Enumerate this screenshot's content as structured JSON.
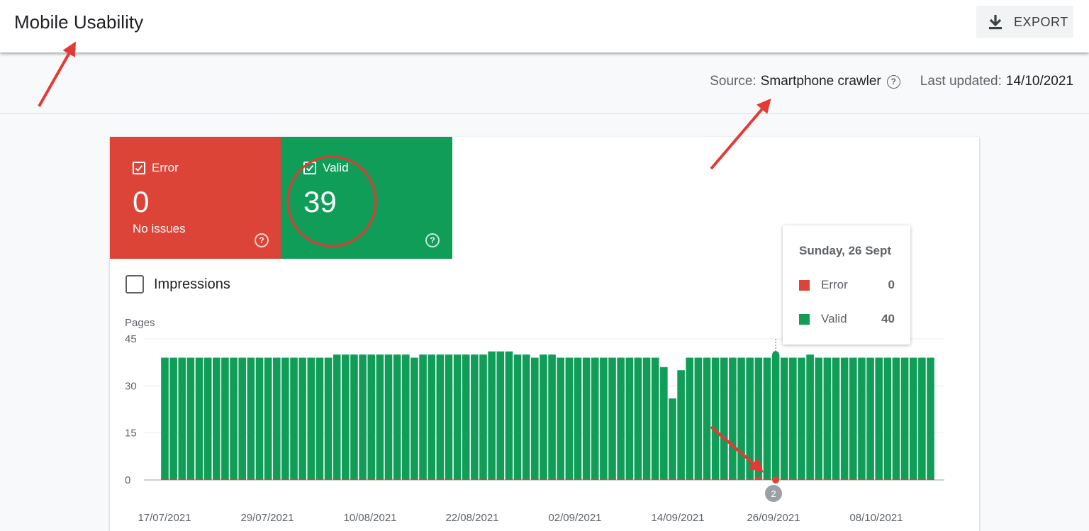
{
  "header": {
    "title": "Mobile Usability",
    "export_label": "EXPORT"
  },
  "info": {
    "source_label": "Source:",
    "source_value": "Smartphone crawler",
    "updated_label": "Last updated:",
    "updated_value": "14/10/2021"
  },
  "tiles": {
    "error": {
      "label": "Error",
      "count": "0",
      "sub": "No issues",
      "color": "#db4437"
    },
    "valid": {
      "label": "Valid",
      "count": "39",
      "color": "#0f9d58"
    }
  },
  "impressions_label": "Impressions",
  "tooltip": {
    "title": "Sunday, 26 Sept",
    "rows": [
      {
        "name": "Error",
        "value": "0",
        "color": "#db4437"
      },
      {
        "name": "Valid",
        "value": "40",
        "color": "#0f9d58"
      }
    ]
  },
  "annotation_marker": "2",
  "chart_data": {
    "type": "bar",
    "ylabel": "Pages",
    "ylim": [
      0,
      45
    ],
    "yticks": [
      0,
      15,
      30,
      45
    ],
    "grid": true,
    "xtick_labels": [
      "17/07/2021",
      "29/07/2021",
      "10/08/2021",
      "22/08/2021",
      "02/09/2021",
      "14/09/2021",
      "26/09/2021",
      "08/10/2021"
    ],
    "x": [
      "17/07/2021",
      "18/07/2021",
      "19/07/2021",
      "20/07/2021",
      "21/07/2021",
      "22/07/2021",
      "23/07/2021",
      "24/07/2021",
      "25/07/2021",
      "26/07/2021",
      "27/07/2021",
      "28/07/2021",
      "29/07/2021",
      "30/07/2021",
      "31/07/2021",
      "01/08/2021",
      "02/08/2021",
      "03/08/2021",
      "04/08/2021",
      "05/08/2021",
      "06/08/2021",
      "07/08/2021",
      "08/08/2021",
      "09/08/2021",
      "10/08/2021",
      "11/08/2021",
      "12/08/2021",
      "13/08/2021",
      "14/08/2021",
      "15/08/2021",
      "16/08/2021",
      "17/08/2021",
      "18/08/2021",
      "19/08/2021",
      "20/08/2021",
      "21/08/2021",
      "22/08/2021",
      "23/08/2021",
      "24/08/2021",
      "25/08/2021",
      "26/08/2021",
      "27/08/2021",
      "28/08/2021",
      "29/08/2021",
      "30/08/2021",
      "31/08/2021",
      "01/09/2021",
      "02/09/2021",
      "03/09/2021",
      "04/09/2021",
      "05/09/2021",
      "06/09/2021",
      "07/09/2021",
      "08/09/2021",
      "09/09/2021",
      "10/09/2021",
      "11/09/2021",
      "12/09/2021",
      "13/09/2021",
      "14/09/2021",
      "15/09/2021",
      "16/09/2021",
      "17/09/2021",
      "18/09/2021",
      "19/09/2021",
      "20/09/2021",
      "21/09/2021",
      "22/09/2021",
      "23/09/2021",
      "24/09/2021",
      "25/09/2021",
      "26/09/2021",
      "27/09/2021",
      "28/09/2021",
      "29/09/2021",
      "30/09/2021",
      "01/10/2021",
      "02/10/2021",
      "03/10/2021",
      "04/10/2021",
      "05/10/2021",
      "06/10/2021",
      "07/10/2021",
      "08/10/2021",
      "09/10/2021",
      "10/10/2021",
      "11/10/2021",
      "12/10/2021",
      "13/10/2021",
      "14/10/2021"
    ],
    "series": [
      {
        "name": "Valid",
        "color": "#0f9d58",
        "values": [
          39,
          39,
          39,
          39,
          39,
          39,
          39,
          39,
          39,
          39,
          39,
          39,
          39,
          39,
          39,
          39,
          39,
          39,
          39,
          39,
          40,
          40,
          40,
          40,
          40,
          40,
          40,
          40,
          40,
          39,
          40,
          40,
          40,
          40,
          40,
          40,
          40,
          40,
          41,
          41,
          41,
          40,
          40,
          39,
          40,
          40,
          39,
          39,
          39,
          39,
          39,
          39,
          39,
          39,
          39,
          39,
          39,
          39,
          36,
          26,
          35,
          39,
          39,
          39,
          39,
          39,
          39,
          39,
          39,
          39,
          39,
          40,
          39,
          39,
          39,
          40,
          39,
          39,
          39,
          39,
          39,
          39,
          39,
          39,
          39,
          39,
          39,
          39,
          39,
          39
        ]
      },
      {
        "name": "Error",
        "color": "#db4437",
        "values": [
          0,
          0,
          0,
          0,
          0,
          0,
          0,
          0,
          0,
          0,
          0,
          0,
          0,
          0,
          0,
          0,
          0,
          0,
          0,
          0,
          0,
          0,
          0,
          0,
          0,
          0,
          0,
          0,
          0,
          0,
          0,
          0,
          0,
          0,
          0,
          0,
          0,
          0,
          0,
          0,
          0,
          0,
          0,
          0,
          0,
          0,
          0,
          0,
          0,
          0,
          0,
          0,
          0,
          0,
          0,
          0,
          0,
          0,
          0,
          0,
          0,
          0,
          0,
          0,
          0,
          0,
          0,
          0,
          0,
          1,
          0,
          0,
          0,
          0,
          0,
          0,
          0,
          0,
          0,
          0,
          0,
          0,
          0,
          0,
          0,
          0,
          0,
          0,
          0,
          0
        ]
      }
    ],
    "highlight_index": 71
  }
}
